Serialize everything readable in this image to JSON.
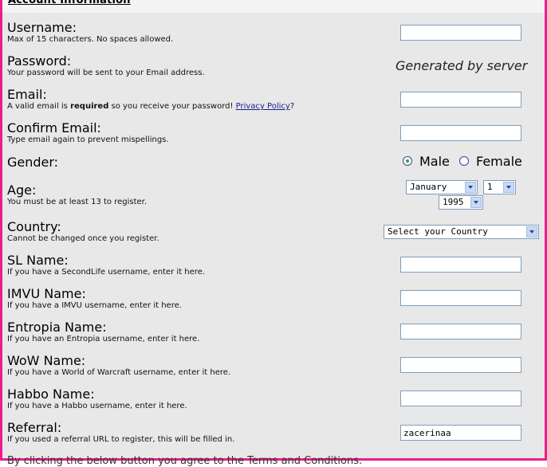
{
  "section": {
    "title": "Account Information"
  },
  "fields": {
    "username": {
      "label": "Username:",
      "hint": "Max of 15 characters. No spaces allowed.",
      "value": ""
    },
    "password": {
      "label": "Password:",
      "hint": "Your password will be sent to your Email address.",
      "value_text": "Generated by server"
    },
    "email": {
      "label": "Email:",
      "hint_pre": "A valid email is ",
      "hint_bold": "required",
      "hint_mid": " so you receive your password! ",
      "hint_link": "Privacy Policy",
      "hint_post": "?",
      "value": ""
    },
    "confirm_email": {
      "label": "Confirm Email:",
      "hint": "Type email again to prevent mispellings.",
      "value": ""
    },
    "gender": {
      "label": "Gender:",
      "options": [
        "Male",
        "Female"
      ],
      "selected": "Male"
    },
    "age": {
      "label": "Age:",
      "hint": "You must be at least 13 to register.",
      "month": "January",
      "day": "1",
      "year": "1995"
    },
    "country": {
      "label": "Country:",
      "hint": "Cannot be changed once you register.",
      "selected": "Select your Country"
    },
    "sl_name": {
      "label": "SL Name:",
      "hint": "If you have a SecondLife username, enter it here.",
      "value": ""
    },
    "imvu_name": {
      "label": "IMVU Name:",
      "hint": "If you have a IMVU username, enter it here.",
      "value": ""
    },
    "entropia_name": {
      "label": "Entropia Name:",
      "hint": "If you have an Entropia username, enter it here.",
      "value": ""
    },
    "wow_name": {
      "label": "WoW Name:",
      "hint": "If you have a World of Warcraft username, enter it here.",
      "value": ""
    },
    "habbo_name": {
      "label": "Habbo Name:",
      "hint": "If you have a Habbo username, enter it here.",
      "value": ""
    },
    "referral": {
      "label": "Referral:",
      "hint": "If you used a referral URL to register, this will be filled in.",
      "value": "zacerinaa"
    }
  },
  "footer": {
    "cut_text": "By clicking the below button you agree to the Terms and Conditions."
  },
  "colors": {
    "border": "#ee1c8c",
    "panel": "#e8e8e8",
    "input_border": "#7f9db9",
    "link": "#1a1a8c"
  }
}
